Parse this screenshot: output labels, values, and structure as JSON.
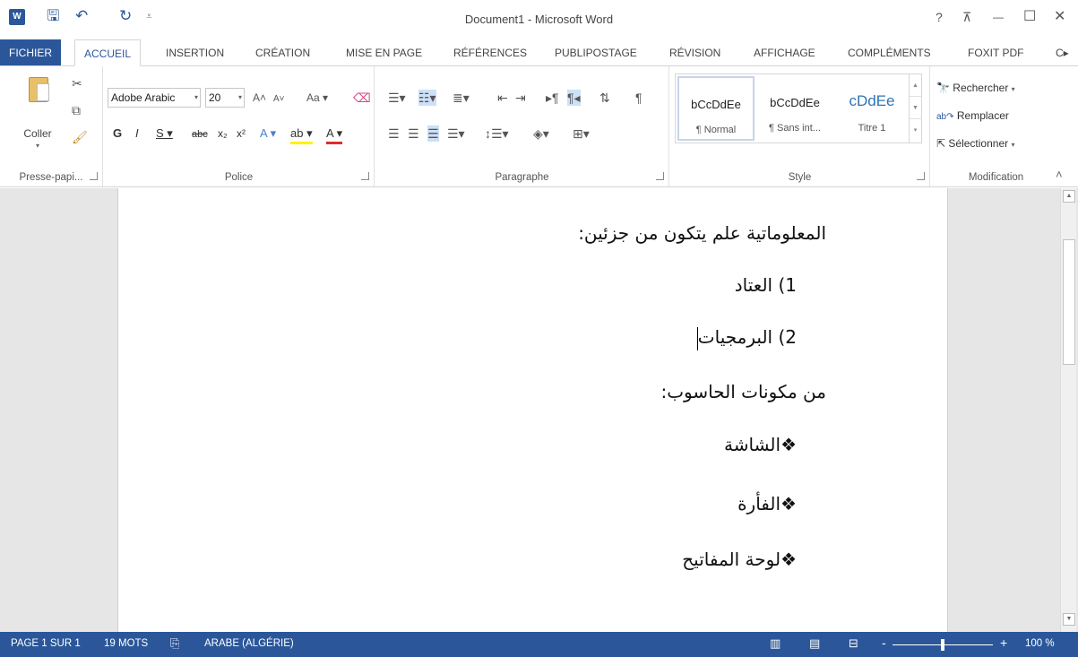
{
  "window": {
    "title": "Document1 - Microsoft Word",
    "help_glyph": "?",
    "ribbon_display_glyph": "⊼",
    "minimize_glyph": "—",
    "maximize_glyph": "☐",
    "close_glyph": "✕"
  },
  "qat": {
    "logo_text": "W",
    "save_glyph": "🖫",
    "undo_glyph": "↶",
    "redo_glyph": "↻",
    "customize_glyph": "⩡"
  },
  "tabs": [
    {
      "label": "FICHIER"
    },
    {
      "label": "ACCUEIL"
    },
    {
      "label": "INSERTION"
    },
    {
      "label": "CRÉATION"
    },
    {
      "label": "MISE EN PAGE"
    },
    {
      "label": "RÉFÉRENCES"
    },
    {
      "label": "PUBLIPOSTAGE"
    },
    {
      "label": "RÉVISION"
    },
    {
      "label": "AFFICHAGE"
    },
    {
      "label": "COMPLÉMENTS"
    },
    {
      "label": "FOXIT PDF"
    },
    {
      "label": "C▸"
    }
  ],
  "ribbon": {
    "clipboard": {
      "paste_label": "Coller",
      "paste_arrow": "▾",
      "group_label": "Presse-papi..."
    },
    "font": {
      "font_name": "Adobe Arabic",
      "font_size": "20",
      "dropdown_glyph": "▾",
      "grow_label": "A˄",
      "shrink_label": "A˅",
      "case_label": "Aa ▾",
      "bold": "G",
      "italic": "I",
      "underline": "S ▾",
      "strike": "abc",
      "subscript": "x₂",
      "superscript": "x²",
      "effects_label": "A ▾",
      "highlight_label": "ab ▾",
      "fontcolor_label": "A ▾",
      "group_label": "Police"
    },
    "paragraph": {
      "group_label": "Paragraphe",
      "pilcrow": "¶"
    },
    "styles": {
      "items": [
        {
          "sample": "bCcDdEe",
          "name": "¶ Normal"
        },
        {
          "sample": "bCcDdEe",
          "name": "¶ Sans int..."
        },
        {
          "sample": "cDdEe",
          "name": "Titre 1"
        }
      ],
      "group_label": "Style"
    },
    "editing": {
      "find": "Rechercher",
      "find_arrow": "▾",
      "replace": "Remplacer",
      "select": "Sélectionner",
      "select_arrow": "▾",
      "group_label": "Modification",
      "collapse_glyph": "˄"
    }
  },
  "document": {
    "lines": [
      "المعلوماتية علم يتكون من جزئين:",
      "1) العتاد",
      "2) البرمجيات",
      "من مكونات الحاسوب:",
      "❖الشاشة",
      "❖الفأرة",
      "❖لوحة المفاتيح"
    ]
  },
  "statusbar": {
    "page": "PAGE 1 SUR 1",
    "words": "19 MOTS",
    "language": "ARABE (ALGÉRIE)",
    "zoom_minus": "-",
    "zoom_plus": "+",
    "zoom": "100 %"
  },
  "colors": {
    "accent": "#2b579a"
  }
}
